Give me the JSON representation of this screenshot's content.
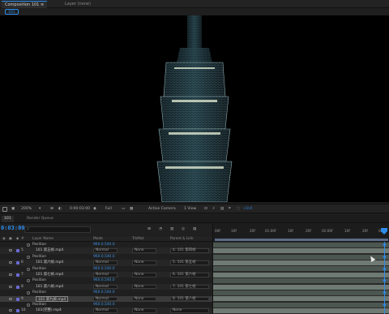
{
  "tabs": {
    "composition": "Composition 101 ≡",
    "layer": "Layer (none)",
    "comp_chip": "101"
  },
  "viewer_toolbar": {
    "zoom": "200%",
    "time": "0:00:03:00",
    "resolution": "Full",
    "camera": "Active Camera",
    "views": "1 View",
    "exposure": "+0.0"
  },
  "timeline": {
    "comp_tab": "101",
    "render_queue": "Render Queue",
    "timecode": "0:03:00",
    "search_placeholder": "ρ",
    "columns": {
      "num": "#",
      "layer_name": "Layer Name",
      "mode": "Mode",
      "trkmat": "TrkMat",
      "parent": "Parent & Link"
    },
    "ruler_ticks": [
      "00f",
      "10f",
      "20f",
      "01:00f",
      "10f",
      "20f",
      "02:00f",
      "10f",
      "20f",
      "03:0"
    ]
  },
  "layers": [
    {
      "kind": "prop",
      "name": "Position",
      "value": "960.0,540.0"
    },
    {
      "kind": "layer",
      "num": "5",
      "name": "101 第五帧.mp4",
      "mode": "Normal",
      "trkmat": "None",
      "parent": "4. 101 第四帧",
      "label": "#6b6bd6"
    },
    {
      "kind": "prop",
      "name": "Position",
      "value": "960.0,540.0"
    },
    {
      "kind": "layer",
      "num": "6",
      "name": "101 第六帧.mp4",
      "mode": "Normal",
      "trkmat": "None",
      "parent": "5. 101 第五帧",
      "label": "#6b6bd6"
    },
    {
      "kind": "prop",
      "name": "Position",
      "value": "960.0,540.0"
    },
    {
      "kind": "layer",
      "num": "7",
      "name": "101 第七帧.mp4",
      "mode": "Normal",
      "trkmat": "None",
      "parent": "6. 101 第六帧",
      "label": "#6b6bd6"
    },
    {
      "kind": "prop",
      "name": "Position",
      "value": "960.0,540.0"
    },
    {
      "kind": "layer",
      "num": "8",
      "name": "101 第八帧.mp4",
      "mode": "Normal",
      "trkmat": "None",
      "parent": "7. 101 第七帧",
      "label": "#6b6bd6"
    },
    {
      "kind": "prop",
      "name": "Position",
      "value": "960.0,540.0"
    },
    {
      "kind": "layer",
      "num": "9",
      "name": "101 第九帧.mp4",
      "mode": "Normal",
      "trkmat": "None",
      "parent": "8. 101 第八帧",
      "label": "#6b6bd6",
      "selected": true
    },
    {
      "kind": "prop",
      "name": "Position",
      "value": "960.0,540.0"
    },
    {
      "kind": "layer",
      "num": "10",
      "name": "101(完整).mp4",
      "mode": "Normal",
      "trkmat": "None",
      "parent": "None",
      "label": "#6b6bd6"
    },
    {
      "kind": "prop",
      "name": "Position",
      "value": "960.0,540.0"
    }
  ],
  "colors": {
    "accent": "#2d8ceb",
    "track_bar": "#6e7a73"
  }
}
